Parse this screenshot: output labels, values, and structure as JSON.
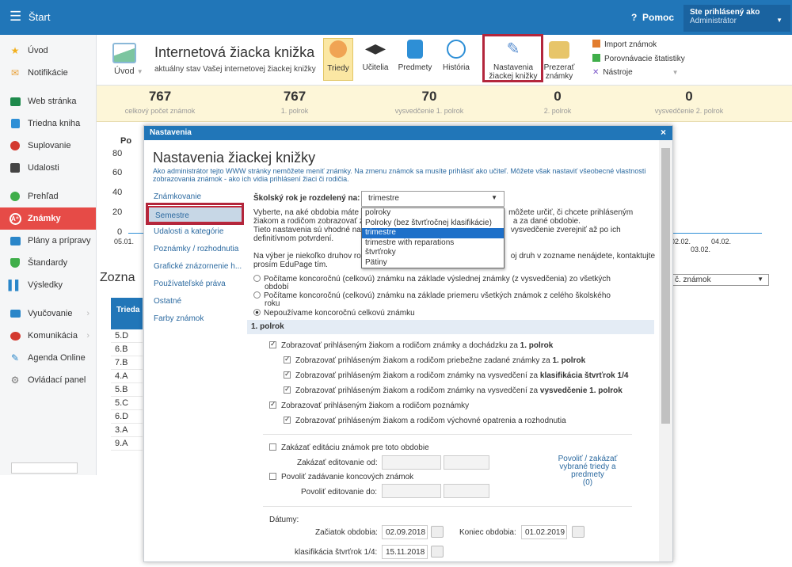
{
  "topbar": {
    "menu_icon": "hamburger-icon",
    "start": "Štart",
    "help": "Pomoc",
    "help_icon": "question-icon",
    "user_line1": "Ste prihlásený ako",
    "user_line2": "Administrátor"
  },
  "sidebar": {
    "items": [
      {
        "label": "Úvod",
        "icon": "star-icon"
      },
      {
        "label": "Notifikácie",
        "icon": "envelope-icon"
      },
      {
        "label": "Web stránka",
        "icon": "web-icon"
      },
      {
        "label": "Triedna kniha",
        "icon": "book-icon"
      },
      {
        "label": "Suplovanie",
        "icon": "user-icon"
      },
      {
        "label": "Udalosti",
        "icon": "calendar-icon"
      },
      {
        "label": "Prehľad",
        "icon": "check-circle-icon"
      },
      {
        "label": "Známky",
        "icon": "grade-icon"
      },
      {
        "label": "Plány a prípravy",
        "icon": "folder-icon"
      },
      {
        "label": "Štandardy",
        "icon": "shield-icon"
      },
      {
        "label": "Výsledky",
        "icon": "bar-chart-icon"
      },
      {
        "label": "Vyučovanie",
        "icon": "board-icon"
      },
      {
        "label": "Komunikácia",
        "icon": "chat-icon"
      },
      {
        "label": "Agenda Online",
        "icon": "pen-icon"
      },
      {
        "label": "Ovládací panel",
        "icon": "gear-icon"
      }
    ]
  },
  "ribbon": {
    "uvod": "Úvod",
    "title": "Internetová žiacka knižka",
    "subtitle": "aktuálny stav Vašej internetovej žiackej knižky",
    "buttons": [
      "Triedy",
      "Učitelia",
      "Predmety",
      "História"
    ],
    "settings_l1": "Nastavenia",
    "settings_l2": "žiackej knižky",
    "browse_l1": "Prezerať",
    "browse_l2": "známky",
    "links": [
      "Import známok",
      "Porovnávacie štatistiky",
      "Nástroje"
    ]
  },
  "stats": [
    {
      "num": "767",
      "lbl": "celkový počet známok"
    },
    {
      "num": "767",
      "lbl": "1. polrok"
    },
    {
      "num": "70",
      "lbl": "vysvedčenie 1. polrok"
    },
    {
      "num": "0",
      "lbl": "2. polrok"
    },
    {
      "num": "0",
      "lbl": "vysvedčenie 2. polrok"
    }
  ],
  "background": {
    "chart_title": "Po",
    "yticks": [
      "80",
      "60",
      "40",
      "20",
      "0"
    ],
    "dates": [
      "05.01.",
      "02.02.",
      "04.02.",
      "03.02."
    ],
    "section": "Zozna",
    "col_header": "Trieda",
    "classes": [
      "5.D",
      "6.B",
      "7.B",
      "4.A",
      "5.B",
      "5.C",
      "6.D",
      "3.A",
      "9.A"
    ],
    "select_label": "č. známok"
  },
  "modal": {
    "header": "Nastavenia",
    "close": "×",
    "title": "Nastavenia žiackej knižky",
    "desc": "Ako administrátor tejto WWW stránky nemôžete meniť známky. Na zmenu známok sa musíte prihlásiť ako učiteľ. Môžete však nastaviť všeobecné vlastnosti zobrazovania známok - ako ich vidia prihlásení žiaci či rodičia.",
    "nav": [
      "Známkovanie",
      "Semestre",
      "Udalosti a kategórie",
      "Poznámky / rozhodnutia",
      "Grafické znázornenie h...",
      "Používateľské práva",
      "Ostatné",
      "Farby známok"
    ],
    "year_label": "Školský rok je rozdelený na:",
    "year_value": "trimestre",
    "year_options": [
      "polroky",
      "Polroky (bez štvrťročnej klasifikácie)",
      "trimestre",
      "trimestre with reparations",
      "štvrťroky",
      "Pätiny"
    ],
    "info1_a": "Vyberte, na aké obdobia máte",
    "info1_b": "môžete určiť, či chcete prihláseným",
    "info2_a": "žiakom a rodičom zobrazovať z",
    "info2_b": "a za dané obdobie.",
    "info3_a": "Tieto nastavenia sú vhodné na",
    "info3_b": "vysvedčenie zverejniť až po ich",
    "info4": "definitívnom potvrdení.",
    "info5_a": "Na výber je niekoľko druhov ro",
    "info5_b": "oj druh v zozname nenájdete, kontaktujte",
    "info6": "prosím EduPage tím.",
    "radio1_l1": "Počítame koncoročnú (celkovú) známku na základe výslednej známky (z vysvedčenia) zo všetkých",
    "radio1_l2": "období",
    "radio2_l1": "Počítame koncoročnú (celkovú) známku na základe priemeru všetkých známok z celého školského",
    "radio2_l2": "roku",
    "radio3": "Nepoužívame koncoročnú celkovú známku",
    "section": "1. polrok",
    "chk1": "Zobrazovať prihláseným žiakom a rodičom známky a dochádzku za ",
    "chk1_b": "1. polrok",
    "chk2": "Zobrazovať prihláseným žiakom a rodičom priebežne zadané známky za ",
    "chk2_b": "1. polrok",
    "chk3": "Zobrazovať prihláseným žiakom a rodičom známky na vysvedčení za ",
    "chk3_b": "klasifikácia štvrťrok 1/4",
    "chk4": "Zobrazovať prihláseným žiakom a rodičom známky na vysvedčení za ",
    "chk4_b": "vysvedčenie 1. polrok",
    "chk5": "Zobrazovať prihláseným žiakom a rodičom poznámky",
    "chk6": "Zobrazovať prihláseným žiakom a rodičom výchovné opatrenia a rozhodnutia",
    "lock_edit": "Zakázať editáciu známok pre toto obdobie",
    "lock_from": "Zakázať editovanie od:",
    "allow_final": "Povoliť zadávanie koncových známok",
    "allow_to": "Povoliť editovanie do:",
    "link_l1": "Povoliť / zakázať",
    "link_l2": "vybrané triedy a",
    "link_l3": "predmety",
    "link_l4": "(0)",
    "dates_label": "Dátumy:",
    "start_label": "Začiatok obdobia:",
    "start_value": "02.09.2018",
    "end_label": "Koniec obdobia:",
    "end_value": "01.02.2019",
    "q_label": "klasifikácia štvrťrok 1/4:",
    "q_value": "15.11.2018"
  }
}
